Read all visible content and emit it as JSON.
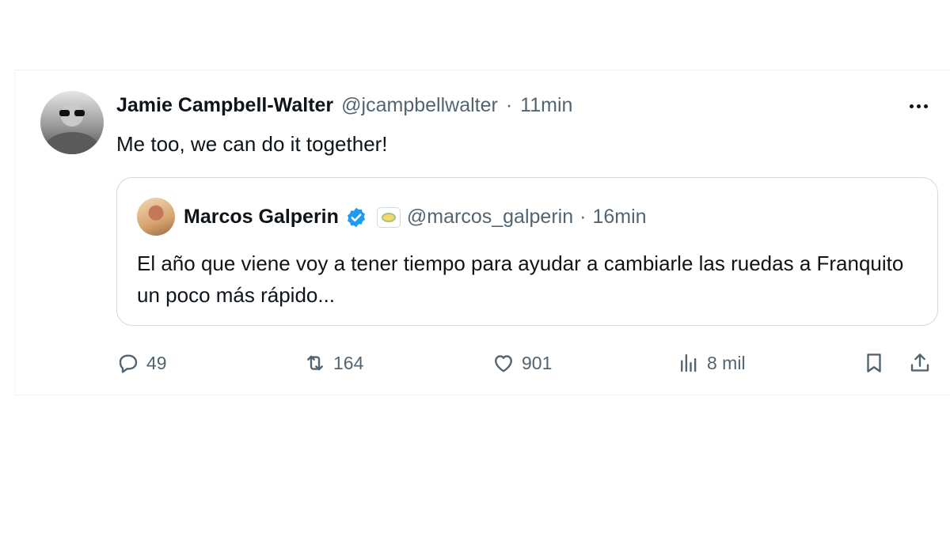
{
  "tweet": {
    "author_name": "Jamie Campbell-Walter",
    "author_handle": "@jcampbellwalter",
    "separator": "·",
    "time": "11min",
    "text": "Me too, we can do it together!"
  },
  "quoted": {
    "author_name": "Marcos Galperin",
    "author_handle": "@marcos_galperin",
    "separator": "·",
    "time": "16min",
    "text": "El año que viene voy a tener tiempo para ayudar a cambiarle las ruedas a Franquito un poco más rápido..."
  },
  "actions": {
    "replies": "49",
    "retweets": "164",
    "likes": "901",
    "views": "8 mil"
  },
  "colors": {
    "verified_badge": "#1d9bf0",
    "secondary_text": "#536471",
    "primary_text": "#0f1419"
  },
  "icons": {
    "reply": "reply-icon",
    "retweet": "retweet-icon",
    "like": "heart-icon",
    "views": "views-chart-icon",
    "bookmark": "bookmark-icon",
    "share": "share-icon",
    "more": "more-horizontal-icon",
    "verified": "verified-badge-icon"
  }
}
